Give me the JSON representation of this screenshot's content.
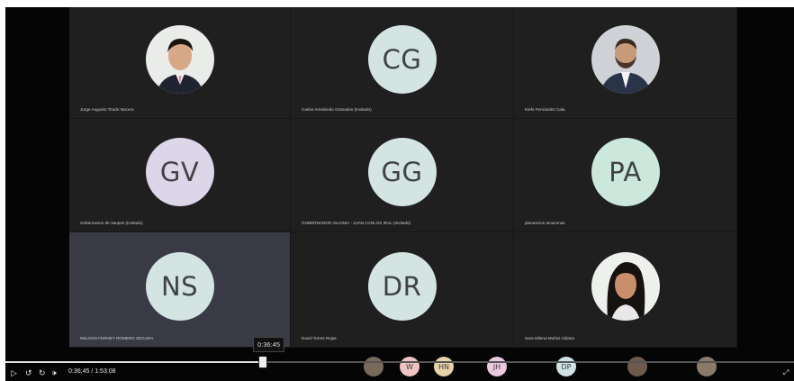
{
  "player": {
    "current_time": "0:36:45",
    "duration": "1:53:08",
    "time_separator": "/",
    "hover_time": "0:36:45",
    "progress": 0.325
  },
  "participants": [
    {
      "name": "Jorge Augusto Tirado Nocera",
      "type": "photo",
      "photo": "man-dark-suit"
    },
    {
      "name": "Carlos Arredondo Granados (Invitado)",
      "initials": "CG",
      "type": "initials",
      "color": "#d3e4e3"
    },
    {
      "name": "Kiefo Fernández Cala",
      "type": "photo",
      "photo": "man-beard"
    },
    {
      "name": "Gobernacion de Vaupes (Invitado)",
      "initials": "GV",
      "type": "initials",
      "color": "#dcd6e8"
    },
    {
      "name": "GOBERNADOR GUAINIA - JUAN CARLOS IRAL (Invitado)",
      "initials": "GG",
      "type": "initials",
      "color": "#d3e4e3"
    },
    {
      "name": "planeacion amazonas",
      "initials": "PA",
      "type": "initials",
      "color": "#cce7dc"
    },
    {
      "name": "NELSON FERNEY ROMERO SEGURA",
      "initials": "NS",
      "type": "initials",
      "color": "#d3e4e3",
      "highlighted": true
    },
    {
      "name": "David Torres Rojas",
      "initials": "DR",
      "type": "initials",
      "color": "#d3e4e3"
    },
    {
      "name": "Sara Milena Muñoz Aldana",
      "type": "photo",
      "photo": "woman"
    }
  ],
  "strip": [
    {
      "type": "photo",
      "color": "#7a6a5c"
    },
    {
      "initials": "W",
      "color": "#f0c3c3"
    },
    {
      "initials": "HN",
      "color": "#e8d2a8"
    },
    {
      "initials": "JH",
      "color": "#ecc9e0"
    },
    {
      "initials": "DP",
      "color": "#cfe3e6"
    },
    {
      "type": "photo",
      "color": "#6e5a4c"
    },
    {
      "type": "photo",
      "color": "#8a7a6a"
    }
  ],
  "icons": {
    "play": "play-icon",
    "rewind": "rewind-icon",
    "forward": "forward-icon",
    "volume": "volume-icon",
    "expand": "expand-icon"
  }
}
